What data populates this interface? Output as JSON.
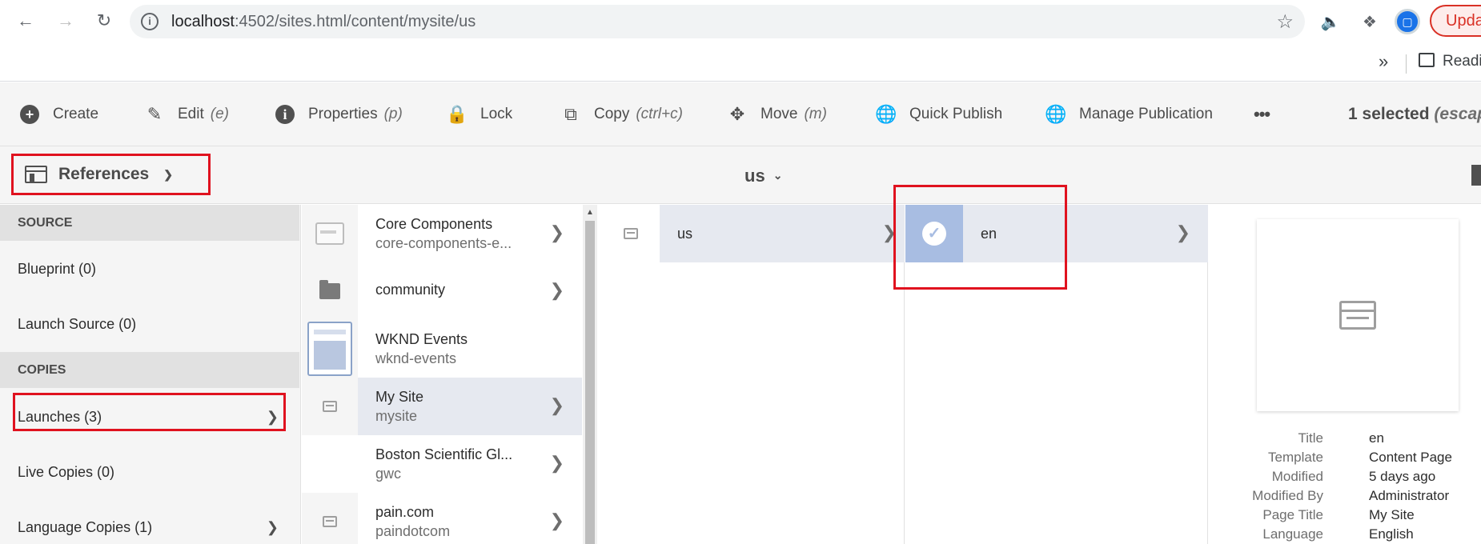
{
  "browser": {
    "url_host": "localhost",
    "url_rest": ":4502/sites.html/content/mysite/us",
    "update_label": "Updat",
    "bookmarks_overflow": "»",
    "reading_list_label": "Readi",
    "icons": [
      "back-icon",
      "forward-icon",
      "reload-icon",
      "info-icon",
      "star-icon",
      "speaker-icon",
      "puzzle-icon",
      "avatar"
    ]
  },
  "toolbar": {
    "actions": [
      {
        "icon": "plus-circle-icon",
        "label": "Create",
        "shortcut": ""
      },
      {
        "icon": "pencil-icon",
        "label": "Edit",
        "shortcut": "(e)"
      },
      {
        "icon": "info-circle-icon",
        "label": "Properties",
        "shortcut": "(p)"
      },
      {
        "icon": "lock-icon",
        "label": "Lock",
        "shortcut": ""
      },
      {
        "icon": "copy-icon",
        "label": "Copy",
        "shortcut": "(ctrl+c)"
      },
      {
        "icon": "move-icon",
        "label": "Move",
        "shortcut": "(m)"
      },
      {
        "icon": "globe-icon",
        "label": "Quick Publish",
        "shortcut": ""
      },
      {
        "icon": "globe-clock-icon",
        "label": "Manage Publication",
        "shortcut": ""
      }
    ],
    "more_label": "•••",
    "selected_count": "1 selected",
    "selected_hint": "(escape"
  },
  "rail": {
    "toggle_label": "References",
    "sections": [
      {
        "title": "SOURCE",
        "items": [
          {
            "label": "Blueprint (0)"
          },
          {
            "label": "Launch Source (0)"
          }
        ]
      },
      {
        "title": "COPIES",
        "items": [
          {
            "label": "Launches (3)"
          },
          {
            "label": "Live Copies (0)"
          },
          {
            "label": "Language Copies (1)"
          }
        ]
      }
    ]
  },
  "header": {
    "path_title": "us"
  },
  "column1": {
    "rows": [
      {
        "title": "Core Components",
        "subtitle": "core-components-e..."
      },
      {
        "title": "community",
        "subtitle": ""
      },
      {
        "title": "WKND Events",
        "subtitle": "wknd-events"
      },
      {
        "title": "My Site",
        "subtitle": "mysite"
      },
      {
        "title": "Boston Scientific Gl...",
        "subtitle": "gwc"
      },
      {
        "title": "pain.com",
        "subtitle": "paindotcom"
      }
    ]
  },
  "column2": {
    "rows": [
      {
        "title": "us"
      }
    ]
  },
  "column3": {
    "rows": [
      {
        "title": "en"
      }
    ]
  },
  "preview": {
    "meta": [
      {
        "label": "Title",
        "value": "en"
      },
      {
        "label": "Template",
        "value": "Content Page"
      },
      {
        "label": "Modified",
        "value": "5 days ago"
      },
      {
        "label": "Modified By",
        "value": "Administrator"
      },
      {
        "label": "Page Title",
        "value": "My Site"
      },
      {
        "label": "Language",
        "value": "English"
      }
    ]
  },
  "colors": {
    "highlight": "#e0121f",
    "selected_row": "#e6e9f0",
    "check_bg": "#a8bde2"
  }
}
